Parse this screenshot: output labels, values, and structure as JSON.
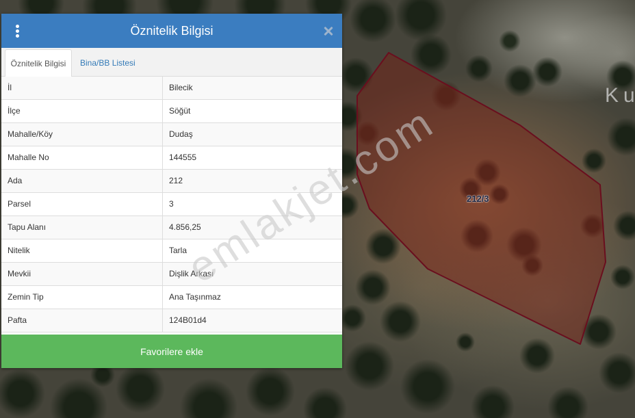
{
  "map": {
    "parcel_label": "212/3",
    "place_label": "Ku",
    "watermark": "emlakjet.com",
    "parcel_fill_color": "#7d1e14",
    "parcel_stroke_color": "#6a0e1e"
  },
  "panel": {
    "title": "Öznitelik Bilgisi",
    "header_color": "#3b7dc0",
    "icons": {
      "menu": "vertical-ellipsis-icon",
      "close": "close-icon"
    },
    "tabs": [
      {
        "label": "Öznitelik Bilgisi",
        "active": true
      },
      {
        "label": "Bina/BB Listesi",
        "active": false
      }
    ],
    "attributes": [
      {
        "label": "İl",
        "value": "Bilecik"
      },
      {
        "label": "İlçe",
        "value": "Söğüt"
      },
      {
        "label": "Mahalle/Köy",
        "value": "Dudaş"
      },
      {
        "label": "Mahalle No",
        "value": "144555"
      },
      {
        "label": "Ada",
        "value": "212"
      },
      {
        "label": "Parsel",
        "value": "3"
      },
      {
        "label": "Tapu Alanı",
        "value": "4.856,25"
      },
      {
        "label": "Nitelik",
        "value": "Tarla"
      },
      {
        "label": "Mevkii",
        "value": "Dişlik Arkası"
      },
      {
        "label": "Zemin Tip",
        "value": "Ana Taşınmaz"
      },
      {
        "label": "Pafta",
        "value": "124B01d4"
      }
    ],
    "favorite_button": {
      "label": "Favorilere ekle",
      "color": "#5cb85c"
    }
  }
}
